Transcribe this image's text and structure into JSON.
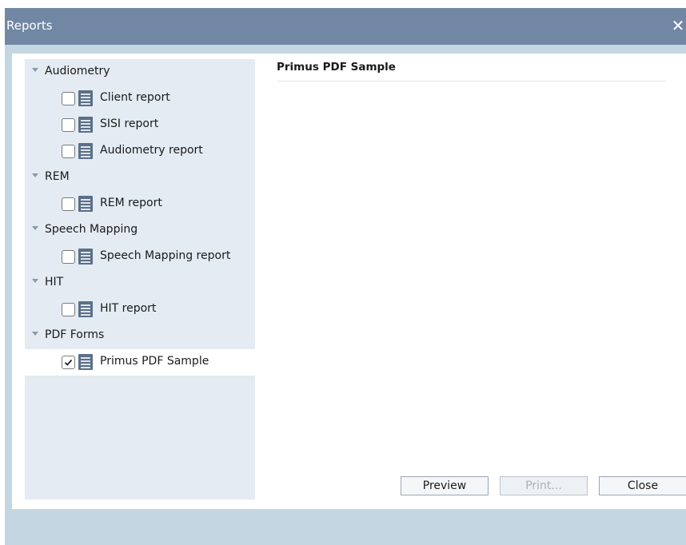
{
  "window": {
    "title": "Reports",
    "close_icon": "close-icon"
  },
  "tree": {
    "groups": [
      {
        "label": "Audiometry",
        "expanded": true,
        "reports": [
          {
            "label": "Client report",
            "checked": false
          },
          {
            "label": "SISI report",
            "checked": false
          },
          {
            "label": "Audiometry report",
            "checked": false
          }
        ]
      },
      {
        "label": "REM",
        "expanded": true,
        "reports": [
          {
            "label": "REM report",
            "checked": false
          }
        ]
      },
      {
        "label": "Speech Mapping",
        "expanded": true,
        "reports": [
          {
            "label": "Speech Mapping report",
            "checked": false
          }
        ]
      },
      {
        "label": "HIT",
        "expanded": true,
        "reports": [
          {
            "label": "HIT report",
            "checked": false
          }
        ]
      },
      {
        "label": "PDF Forms",
        "expanded": true,
        "reports": [
          {
            "label": "Primus PDF Sample",
            "checked": true,
            "selected": true
          }
        ]
      }
    ]
  },
  "preview": {
    "title": "Primus PDF Sample"
  },
  "buttons": {
    "preview": "Preview",
    "print": "Print...",
    "close": "Close"
  },
  "colors": {
    "titlebar": "#7187a4",
    "dialog_background": "#c5d6e3",
    "tree_background": "#e4ebf2",
    "doc_icon": "#5b6f88"
  }
}
